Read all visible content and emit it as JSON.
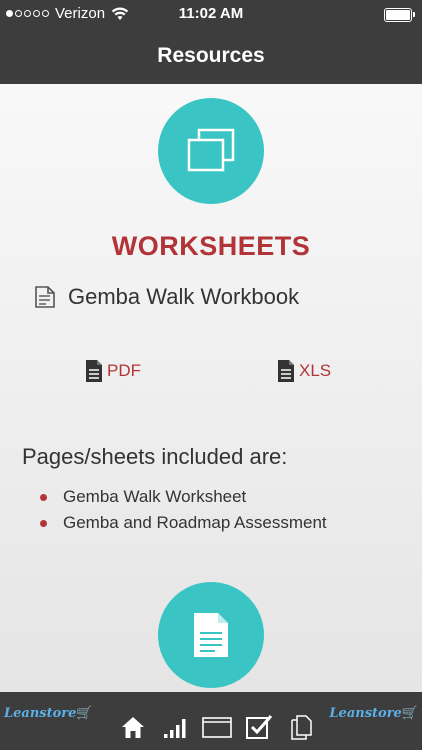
{
  "status_bar": {
    "carrier": "Verizon",
    "time": "11:02 AM"
  },
  "nav": {
    "title": "Resources"
  },
  "section": {
    "title": "WORKSHEETS",
    "workbook_title": "Gemba Walk Workbook",
    "links": {
      "pdf_label": "PDF",
      "xls_label": "XLS"
    },
    "included_heading": "Pages/sheets included are:",
    "included_items": [
      "Gemba Walk Worksheet",
      "Gemba and Roadmap Assessment"
    ]
  },
  "tab_bar": {
    "logo_text": "Leanstore",
    "tabs": [
      {
        "icon": "home-icon"
      },
      {
        "icon": "signal-bars-icon"
      },
      {
        "icon": "window-icon"
      },
      {
        "icon": "checkbox-icon"
      },
      {
        "icon": "documents-icon"
      }
    ]
  },
  "colors": {
    "accent_red": "#b33438",
    "accent_teal": "#3ac4c4",
    "bar_dark": "#3d3d3d"
  }
}
